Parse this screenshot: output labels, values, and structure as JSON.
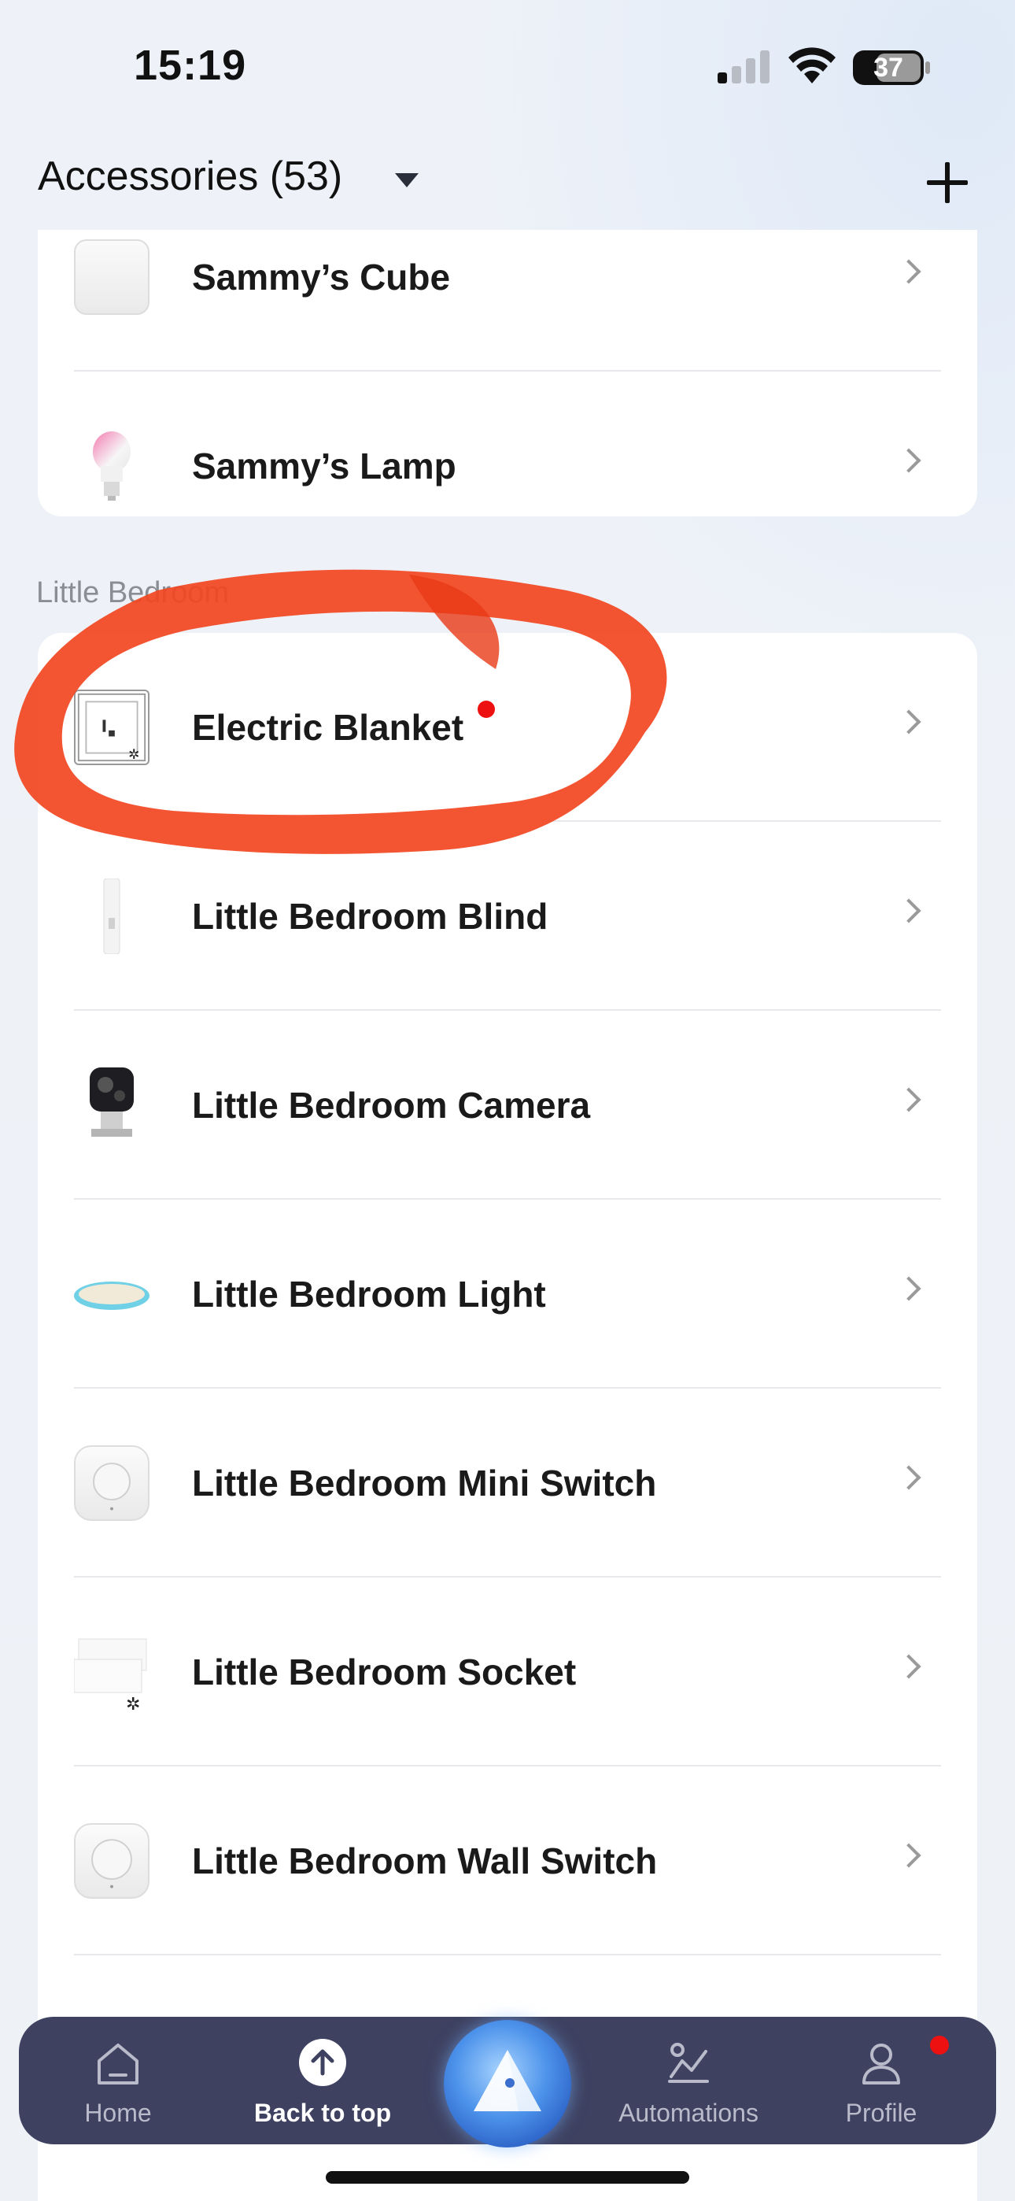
{
  "status_bar": {
    "time": "15:19",
    "battery": "37"
  },
  "header": {
    "title": "Accessories (53)",
    "add_icon": "plus-icon",
    "dropdown_icon": "caret-down-icon"
  },
  "groups": [
    {
      "name": "",
      "items": [
        {
          "label": "Sammy’s Cube",
          "icon": "cube-icon"
        },
        {
          "label": "Sammy’s Lamp",
          "icon": "lamp-bulb-icon"
        }
      ]
    },
    {
      "name": "Little Bedroom",
      "items": [
        {
          "label": "Electric Blanket",
          "icon": "socket-icon",
          "badge": "red-dot"
        },
        {
          "label": "Little Bedroom Blind",
          "icon": "blind-icon"
        },
        {
          "label": "Little Bedroom Camera",
          "icon": "camera-icon"
        },
        {
          "label": "Little Bedroom Light",
          "icon": "ceiling-light-icon"
        },
        {
          "label": "Little Bedroom Mini Switch",
          "icon": "mini-switch-icon"
        },
        {
          "label": "Little Bedroom Socket",
          "icon": "socket-icon"
        },
        {
          "label": "Little Bedroom Wall Switch",
          "icon": "wall-switch-icon"
        }
      ]
    }
  ],
  "bottom_nav": {
    "home": "Home",
    "back_to_top": "Back to top",
    "automations": "Automations",
    "profile": "Profile"
  },
  "colors": {
    "nav_background": "#3e4160",
    "badge_red": "#ee1111",
    "annotation_red": "#f2451f"
  }
}
